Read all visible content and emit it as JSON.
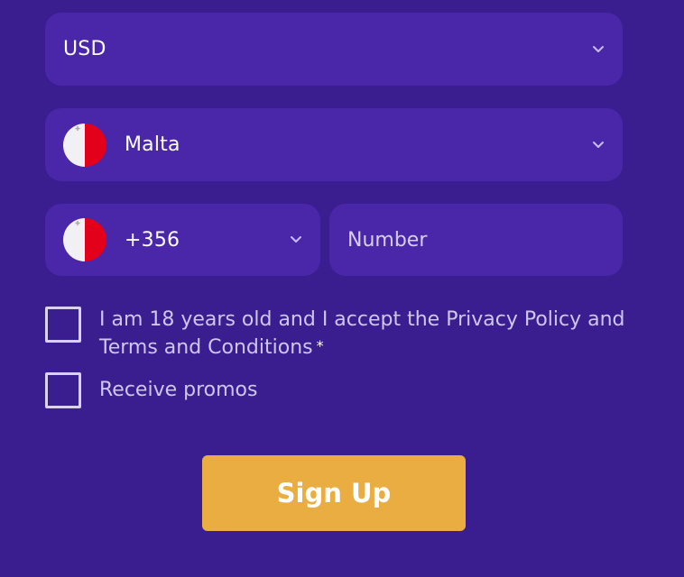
{
  "form": {
    "currency": {
      "value": "USD"
    },
    "country": {
      "value": "Malta",
      "flag": "malta-flag"
    },
    "phone": {
      "code": "+356",
      "flag": "malta-flag",
      "number_placeholder": "Number",
      "number_value": ""
    },
    "terms": {
      "label": "I am 18 years old and I accept the Privacy Policy and Terms and Conditions",
      "required_marker": "*",
      "checked": false
    },
    "promos": {
      "label": "Receive promos",
      "checked": false
    },
    "submit_label": "Sign Up"
  },
  "colors": {
    "background": "#3a1d8f",
    "field": "#4a27a9",
    "button": "#e9ad42",
    "flag_red": "#e2001a",
    "flag_white": "#f1f0f5"
  },
  "icons": [
    "chevron-down-icon",
    "malta-flag-icon",
    "checkbox-icon"
  ]
}
